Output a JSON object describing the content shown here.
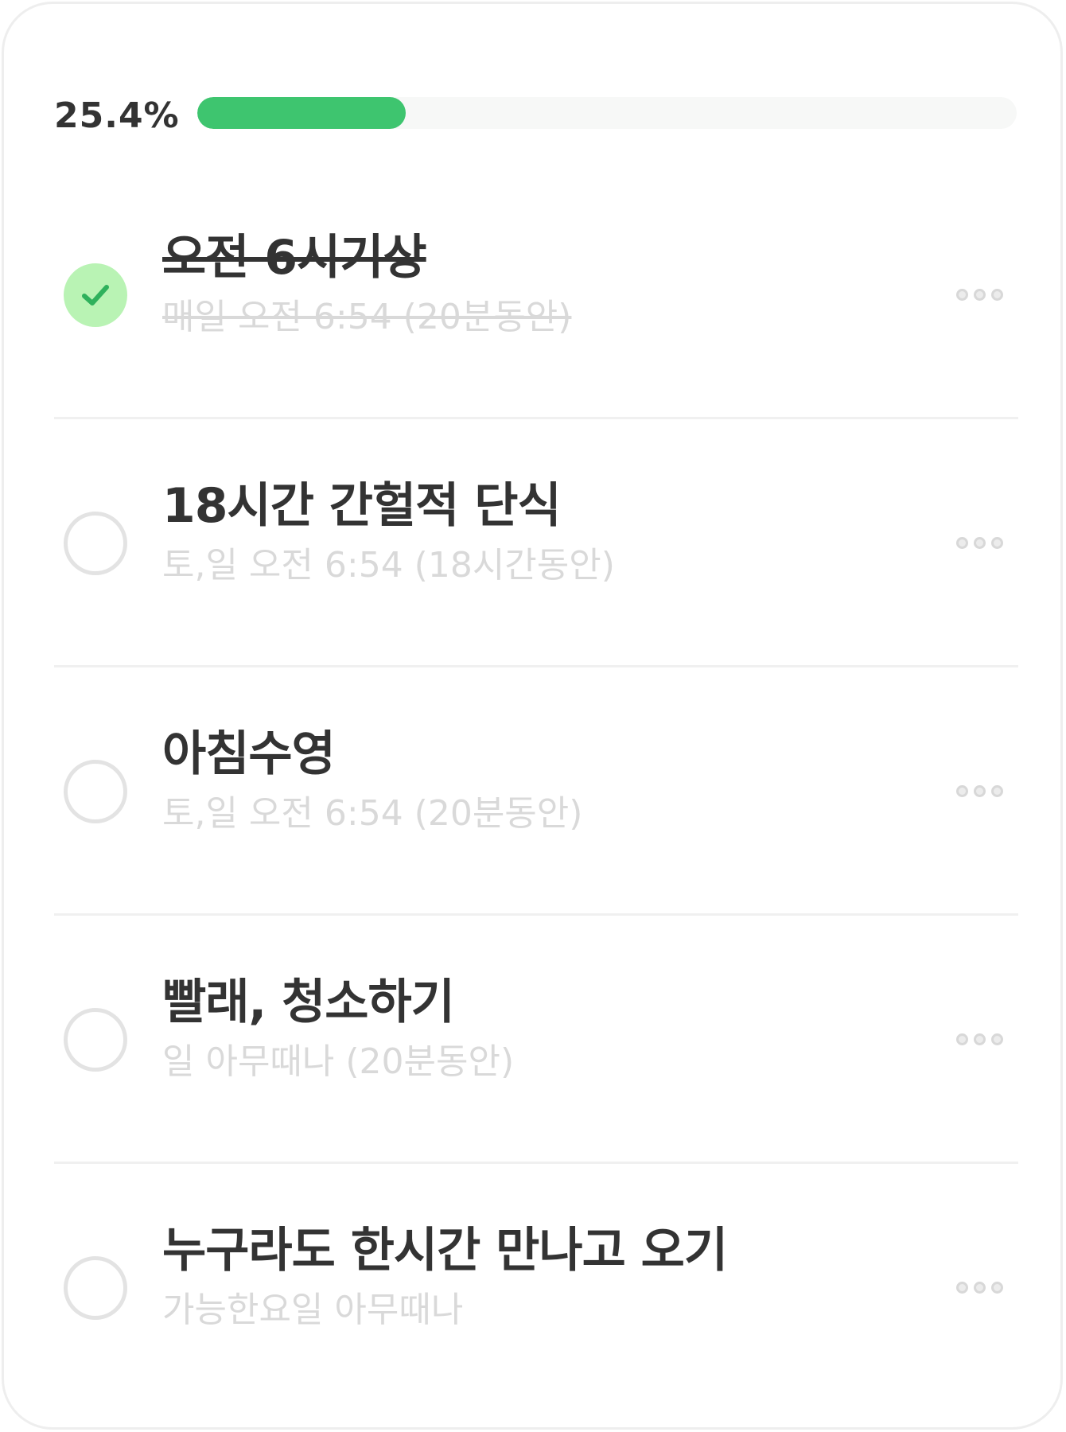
{
  "progress": {
    "label": "25.4%",
    "value": 0.254,
    "fill_color": "#3ec56f"
  },
  "tasks": [
    {
      "title": "오전 6시기상",
      "subtitle": "매일 오전 6:54 (20분동안)",
      "done": true
    },
    {
      "title": "18시간 간헐적 단식",
      "subtitle": "토,일 오전 6:54 (18시간동안)",
      "done": false
    },
    {
      "title": "아침수영",
      "subtitle": "토,일 오전 6:54 (20분동안)",
      "done": false
    },
    {
      "title": "빨래, 청소하기",
      "subtitle": "일 아무때나 (20분동안)",
      "done": false
    },
    {
      "title": "누구라도 한시간 만나고 오기",
      "subtitle": "가능한요일 아무때나",
      "done": false
    }
  ],
  "icons": {
    "check": "checkmark-icon",
    "more": "more-horizontal-icon"
  },
  "colors": {
    "check_done_bg": "#b9f3b4",
    "check_mark": "#2fb15c"
  }
}
